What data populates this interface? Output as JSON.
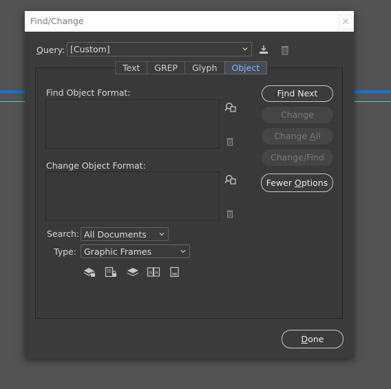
{
  "window": {
    "title": "Find/Change"
  },
  "query": {
    "label": "Query:",
    "value": "[Custom]"
  },
  "tabs": [
    {
      "label": "Text",
      "active": false
    },
    {
      "label": "GREP",
      "active": false
    },
    {
      "label": "Glyph",
      "active": false
    },
    {
      "label": "Object",
      "active": true
    }
  ],
  "find_format": {
    "label": "Find Object Format:"
  },
  "change_format": {
    "label": "Change Object Format:"
  },
  "search": {
    "label": "Search:",
    "value": "All Documents"
  },
  "type": {
    "label": "Type:",
    "value": "Graphic Frames"
  },
  "buttons": {
    "find_next": {
      "pre": "F",
      "u": "i",
      "post": "nd Next"
    },
    "change": "Change",
    "change_all": {
      "pre": "Change ",
      "u": "A",
      "post": "ll"
    },
    "change_find": "Change/Find",
    "fewer_options": {
      "pre": "Fewer ",
      "u": "O",
      "post": "ptions"
    },
    "done": {
      "pre": "",
      "u": "D",
      "post": "one"
    }
  },
  "colors": {
    "accent": "#1e6fc0",
    "active_tab_text": "#7eb6ff",
    "background": "#535353"
  },
  "icons": [
    "save-query-icon",
    "delete-query-icon",
    "specify-attributes-icon",
    "clear-attributes-icon",
    "include-locked-layers-icon",
    "include-locked-stories-icon",
    "include-hidden-layers-icon",
    "include-master-pages-icon",
    "include-footnotes-icon"
  ]
}
